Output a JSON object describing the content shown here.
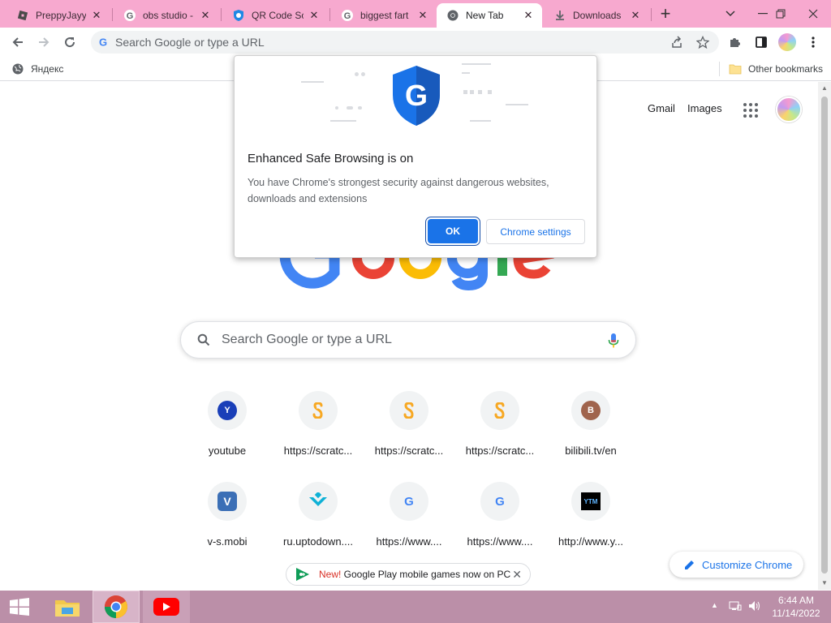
{
  "tabs": [
    {
      "title": "PreppyJayy",
      "icon": "roblox-icon"
    },
    {
      "title": "obs studio -",
      "icon": "google-icon"
    },
    {
      "title": "QR Code Sc",
      "icon": "qr-shield-icon"
    },
    {
      "title": "biggest fart",
      "icon": "google-icon"
    },
    {
      "title": "New Tab",
      "icon": "chrome-icon",
      "active": true
    },
    {
      "title": "Downloads",
      "icon": "download-icon"
    }
  ],
  "toolbar": {
    "omnibox_placeholder": "Search Google or type a URL"
  },
  "bookmarks": {
    "yandex": "Яндекс",
    "other": "Other bookmarks"
  },
  "ntp": {
    "gmail": "Gmail",
    "images": "Images",
    "search_placeholder": "Search Google or type a URL",
    "shortcuts": [
      {
        "label": "youtube",
        "icon_letter": "Y",
        "icon_color": "#1a3fb8"
      },
      {
        "label": "https://scratc...",
        "icon_letter": "S",
        "icon_color": "#f7a823"
      },
      {
        "label": "https://scratc...",
        "icon_letter": "S",
        "icon_color": "#f7a823"
      },
      {
        "label": "https://scratc...",
        "icon_letter": "S",
        "icon_color": "#f7a823"
      },
      {
        "label": "bilibili.tv/en",
        "icon_letter": "B",
        "icon_color": "#a0644d"
      },
      {
        "label": "v-s.mobi",
        "icon_letter": "V",
        "icon_color": "#3b6fb6"
      },
      {
        "label": "ru.uptodown....",
        "icon_letter": "",
        "icon_color": "#0fb1d6"
      },
      {
        "label": "https://www....",
        "icon_letter": "G",
        "icon_color": "#4285f4"
      },
      {
        "label": "https://www....",
        "icon_letter": "G",
        "icon_color": "#4285f4"
      },
      {
        "label": "http://www.y...",
        "icon_letter": "YTM",
        "icon_color": "#000000"
      }
    ],
    "promo_new": "New!",
    "promo_text": " Google Play mobile games now on PC",
    "customize": "Customize Chrome"
  },
  "popup": {
    "heading": "Enhanced Safe Browsing is on",
    "body": "You have Chrome's strongest security against dangerous websites, downloads and extensions",
    "ok": "OK",
    "settings": "Chrome settings"
  },
  "taskbar": {
    "time": "6:44 AM",
    "date": "11/14/2022"
  },
  "colors": {
    "tabstrip": "#f7a9cf",
    "taskbar": "#bb8fa8",
    "accent": "#1a73e8"
  }
}
